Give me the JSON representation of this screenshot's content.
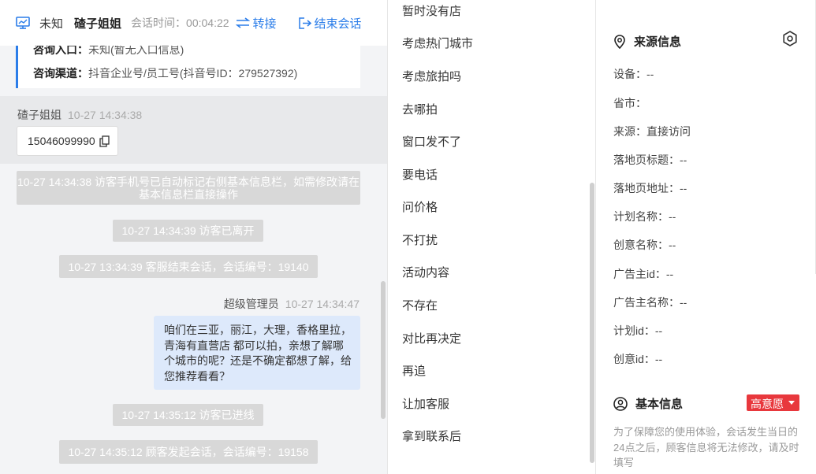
{
  "header": {
    "unknown": "未知",
    "customer_name": "碴子姐姐",
    "session_time_label": "会话时间：",
    "session_time": "00:04:22",
    "transfer_label": "转接",
    "end_label": "结束会话",
    "accent_color": "#2b7de9"
  },
  "source_card": {
    "entry_label": "咨询入口：",
    "entry_value": "未知(暂无入口信息)",
    "channel_label": "咨询渠道：",
    "channel_value": "抖音企业号/员工号(抖音号ID：279527392)"
  },
  "phone_msg": {
    "sender": "碴子姐姐",
    "time": "10-27 14:34:38",
    "phone": "15046099990"
  },
  "system_messages": [
    "10-27 14:34:38 访客手机号已自动标记右侧基本信息栏，如需修改请在基本信息栏直接操作",
    "10-27 14:34:39 访客已离开",
    "10-27 13:34:39 客服结束会话，会话编号：19140",
    "10-27 14:35:12 访客已进线",
    "10-27 14:35:12 顾客发起会话，会话编号：19158"
  ],
  "agent_msg": {
    "sender": "超级管理员",
    "time": "10-27 14:34:47",
    "text": "咱们在三亚，丽江，大理，香格里拉，青海有直营店 都可以拍，亲想了解哪个城市的呢？还是不确定都想了解，给您推荐看看？"
  },
  "quick_replies": [
    "暂时没有店",
    "考虑热门城市",
    "考虑旅拍吗",
    "去哪拍",
    "窗口发不了",
    "要电话",
    "问价格",
    "不打扰",
    "活动内容",
    "不存在",
    "对比再决定",
    "再追",
    "让加客服",
    "拿到联系后"
  ],
  "source_info": {
    "title": "来源信息",
    "fields": [
      "设备：--",
      "省市：",
      "来源：直接访问",
      "落地页标题：--",
      "落地页地址：--",
      "计划名称：--",
      "创意名称：--",
      "广告主id：--",
      "广告主名称：--",
      "计划id：--",
      "创意id：--"
    ]
  },
  "basic_info": {
    "title": "基本信息",
    "intent_badge": "高意愿",
    "badge_color": "#e8383d",
    "notice": "为了保障您的使用体验，会话发生当日的24点之后，顾客信息将无法修改，请及时填写"
  }
}
